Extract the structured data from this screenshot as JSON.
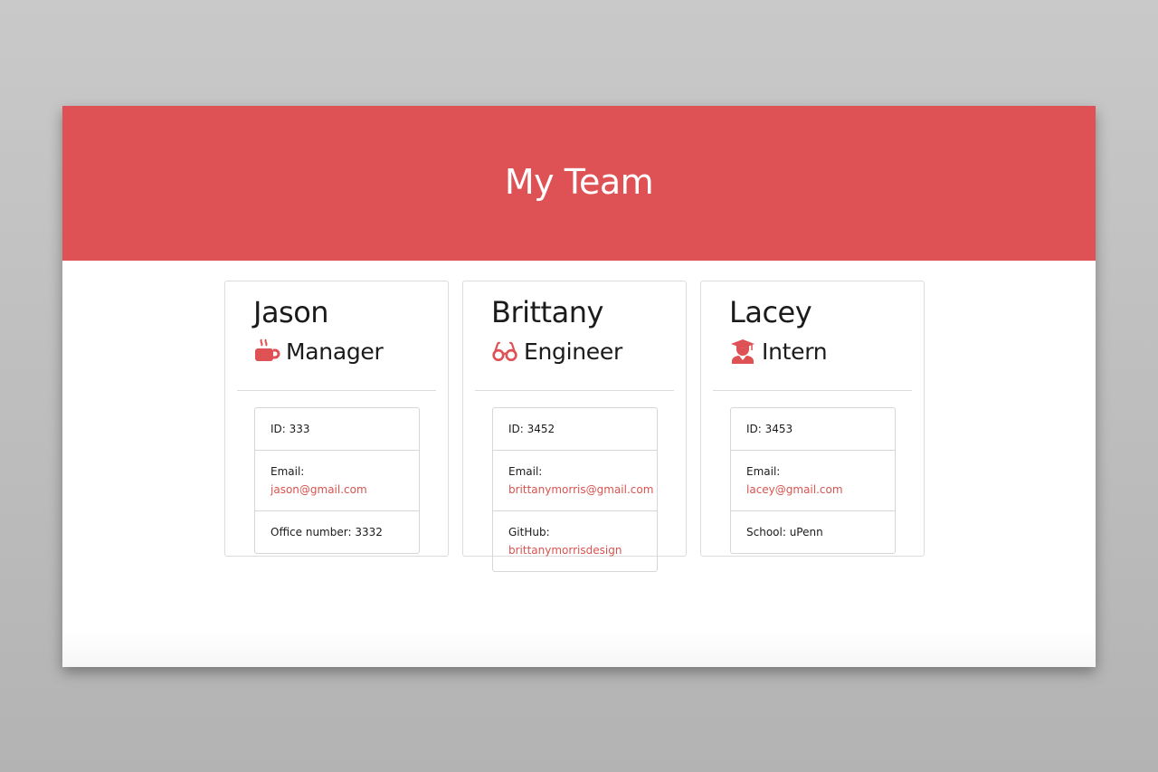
{
  "header": {
    "title": "My Team"
  },
  "colors": {
    "accent": "#de5255",
    "link": "#d9534f"
  },
  "employees": [
    {
      "name": "Jason",
      "role": "Manager",
      "icon": "coffee-mug-icon",
      "details": [
        {
          "label": "ID: 333",
          "value": ""
        },
        {
          "label": "Email: ",
          "value": "jason@gmail.com"
        },
        {
          "label": "Office number: 3332",
          "value": ""
        }
      ]
    },
    {
      "name": "Brittany",
      "role": "Engineer",
      "icon": "glasses-icon",
      "details": [
        {
          "label": "ID: 3452",
          "value": ""
        },
        {
          "label": "Email: ",
          "value": "brittanymorris@gmail.com"
        },
        {
          "label": "GitHub: ",
          "value": "brittanymorrisdesign"
        }
      ]
    },
    {
      "name": "Lacey",
      "role": "Intern",
      "icon": "graduate-icon",
      "details": [
        {
          "label": "ID: 3453",
          "value": ""
        },
        {
          "label": "Email: ",
          "value": "lacey@gmail.com"
        },
        {
          "label": "School: uPenn",
          "value": ""
        }
      ]
    }
  ]
}
